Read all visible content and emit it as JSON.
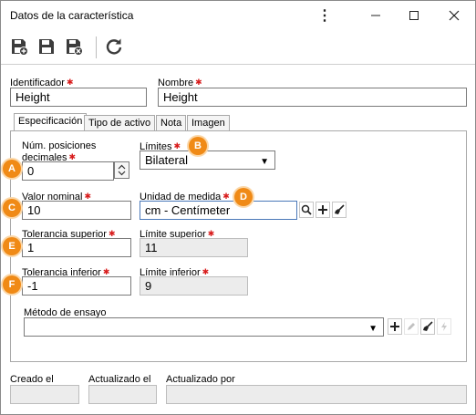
{
  "window": {
    "title": "Datos de la característica"
  },
  "form": {
    "identificador": {
      "label": "Identificador",
      "value": "Height"
    },
    "nombre": {
      "label": "Nombre",
      "value": "Height"
    }
  },
  "tabs": [
    {
      "label": "Especificación",
      "active": true
    },
    {
      "label": "Tipo de activo"
    },
    {
      "label": "Nota"
    },
    {
      "label": "Imagen"
    }
  ],
  "spec": {
    "num_posiciones": {
      "label_line1": "Núm. posiciones",
      "label_line2": "decimales",
      "value": "0"
    },
    "limites": {
      "label": "Límites",
      "value": "Bilateral"
    },
    "valor_nominal": {
      "label": "Valor nominal",
      "value": "10"
    },
    "unidad": {
      "label": "Unidad de medida",
      "value": "cm - Centímeter"
    },
    "tol_superior": {
      "label": "Tolerancia superior",
      "value": "1"
    },
    "lim_superior": {
      "label": "Límite superior",
      "value": "11"
    },
    "tol_inferior": {
      "label": "Tolerancia inferior",
      "value": "-1"
    },
    "lim_inferior": {
      "label": "Límite inferior",
      "value": "9"
    },
    "metodo": {
      "label": "Método de ensayo",
      "value": ""
    }
  },
  "footer": {
    "creado": {
      "label": "Creado el",
      "value": ""
    },
    "actualizado": {
      "label": "Actualizado el",
      "value": ""
    },
    "actualizado_por": {
      "label": "Actualizado por",
      "value": ""
    }
  },
  "callouts": [
    "A",
    "B",
    "C",
    "D",
    "E",
    "F"
  ],
  "colors": {
    "callout": "#f08a16",
    "required": "#d81c1c",
    "readonly_bg": "#ececec"
  }
}
